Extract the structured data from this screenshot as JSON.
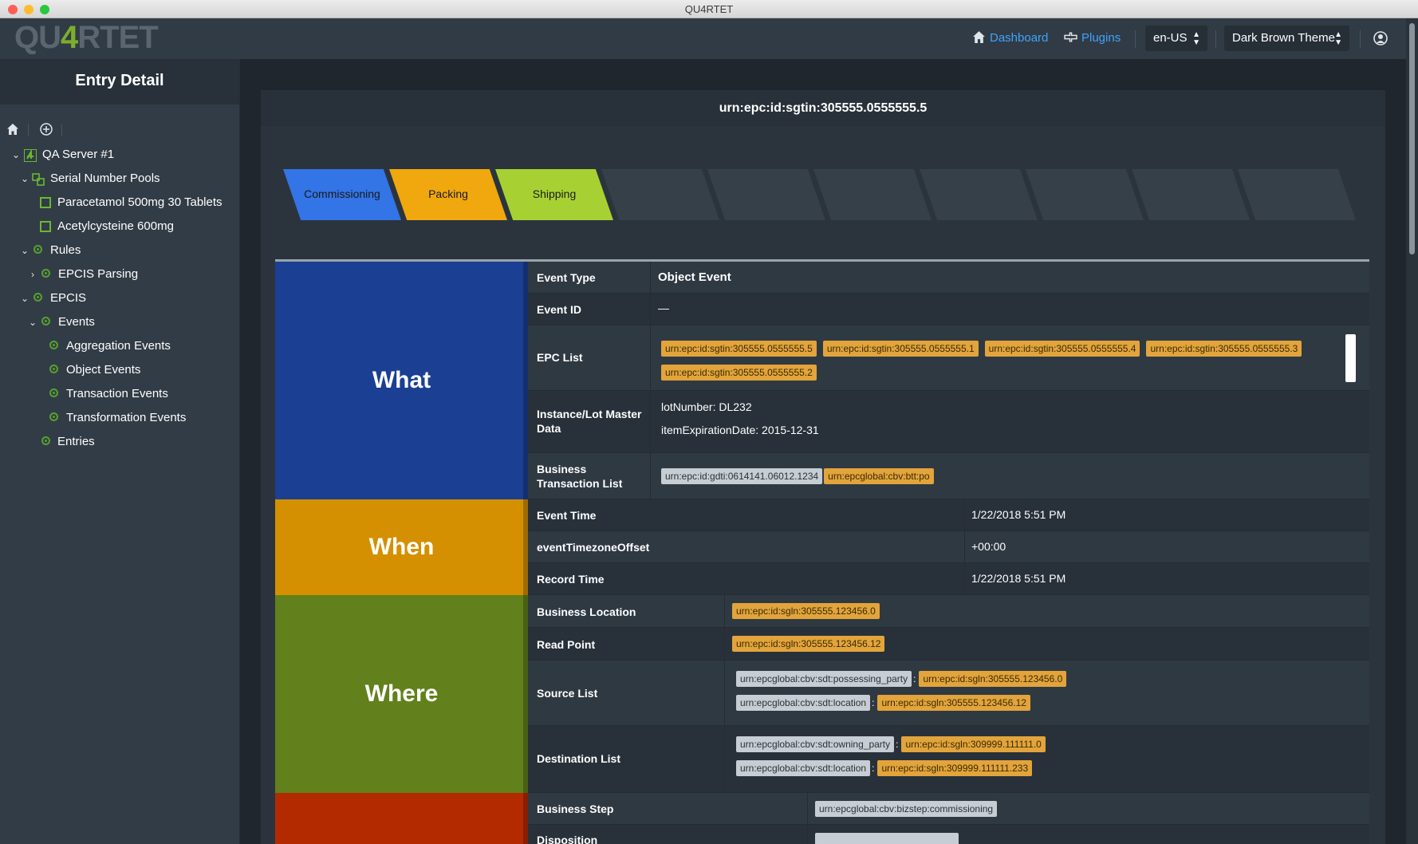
{
  "window": {
    "title": "QU4RTET"
  },
  "header": {
    "logo_left": "QU",
    "logo_four": "4",
    "logo_right": "RTET",
    "dashboard": "Dashboard",
    "plugins": "Plugins",
    "language": "en-US",
    "theme": "Dark Brown Theme"
  },
  "sidebar": {
    "title": "Entry Detail",
    "tree": {
      "server": "QA Server #1",
      "pools": "Serial Number Pools",
      "pool1": "Paracetamol 500mg 30 Tablets",
      "pool2": "Acetylcysteine 600mg",
      "rules": "Rules",
      "parsing": "EPCIS Parsing",
      "epcis": "EPCIS",
      "events": "Events",
      "agg": "Aggregation Events",
      "obj": "Object Events",
      "trans": "Transaction Events",
      "transform": "Transformation Events",
      "entries": "Entries"
    }
  },
  "main": {
    "title": "urn:epc:id:sgtin:305555.0555555.5",
    "steps": [
      "Commissioning",
      "Packing",
      "Shipping",
      "",
      "",
      "",
      "",
      "",
      "",
      ""
    ],
    "step_colors": [
      "#3374e6",
      "#f0a80e",
      "#a7d133",
      "#354049",
      "#354049",
      "#354049",
      "#354049",
      "#354049",
      "#354049",
      "#354049"
    ],
    "blocks": {
      "what": "What",
      "when": "When",
      "where": "Where",
      "why": ""
    },
    "what": {
      "event_type_label": "Event Type",
      "event_type": "Object Event",
      "event_id_label": "Event ID",
      "event_id": "—",
      "epc_list_label": "EPC List",
      "epcs": [
        "urn:epc:id:sgtin:305555.0555555.5",
        "urn:epc:id:sgtin:305555.0555555.1",
        "urn:epc:id:sgtin:305555.0555555.4",
        "urn:epc:id:sgtin:305555.0555555.3",
        "urn:epc:id:sgtin:305555.0555555.2"
      ],
      "master_label": "Instance/Lot Master Data",
      "lot": "lotNumber: DL232",
      "expiry": "itemExpirationDate: 2015-12-31",
      "btl_label": "Business Transaction List",
      "btl_id": "urn:epc:id:gdti:0614141.06012.1234",
      "btl_type": "urn:epcglobal:cbv:btt:po"
    },
    "when": {
      "event_time_label": "Event Time",
      "event_time": "1/22/2018 5:51 PM",
      "tz_label": "eventTimezoneOffset",
      "tz": "+00:00",
      "record_time_label": "Record Time",
      "record_time": "1/22/2018 5:51 PM"
    },
    "where": {
      "biz_loc_label": "Business Location",
      "biz_loc": "urn:epc:id:sgln:305555.123456.0",
      "read_point_label": "Read Point",
      "read_point": "urn:epc:id:sgln:305555.123456.12",
      "source_label": "Source List",
      "source1_type": "urn:epcglobal:cbv:sdt:possessing_party",
      "source1_val": "urn:epc:id:sgln:305555.123456.0",
      "source2_type": "urn:epcglobal:cbv:sdt:location",
      "source2_val": "urn:epc:id:sgln:305555.123456.12",
      "dest_label": "Destination List",
      "dest1_type": "urn:epcglobal:cbv:sdt:owning_party",
      "dest1_val": "urn:epc:id:sgln:309999.111111.0",
      "dest2_type": "urn:epcglobal:cbv:sdt:location",
      "dest2_val": "urn:epc:id:sgln:309999.111111.233"
    },
    "why": {
      "biz_step_label": "Business Step",
      "biz_step": "urn:epcglobal:cbv:bizstep:commissioning",
      "disposition_label": "Disposition"
    }
  }
}
